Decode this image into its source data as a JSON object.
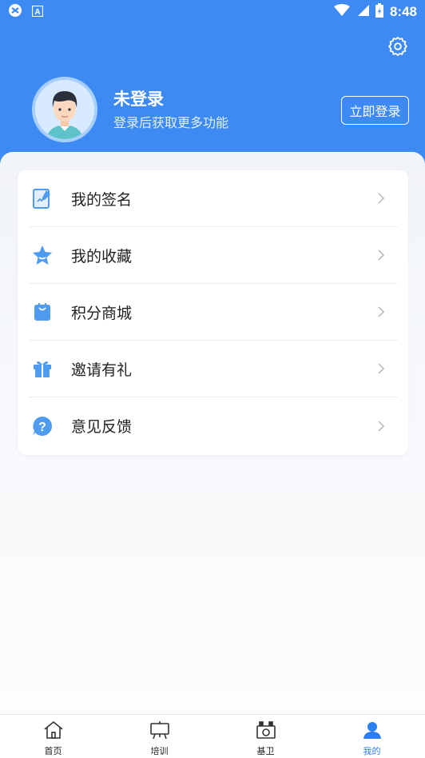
{
  "status_bar": {
    "time": "8:48",
    "left_icons": [
      "app-icon",
      "a-icon"
    ],
    "right_icons": [
      "wifi-icon",
      "signal-icon",
      "battery-icon"
    ]
  },
  "profile": {
    "name": "未登录",
    "subtitle": "登录后获取更多功能",
    "login_button": "立即登录"
  },
  "menu": {
    "items": [
      {
        "label": "我的签名",
        "icon": "signature-icon"
      },
      {
        "label": "我的收藏",
        "icon": "star-icon"
      },
      {
        "label": "积分商城",
        "icon": "shopping-bag-icon"
      },
      {
        "label": "邀请有礼",
        "icon": "gift-icon"
      },
      {
        "label": "意见反馈",
        "icon": "feedback-icon"
      }
    ]
  },
  "tabs": [
    {
      "label": "首页",
      "icon": "home-icon",
      "active": false
    },
    {
      "label": "培训",
      "icon": "training-icon",
      "active": false
    },
    {
      "label": "基卫",
      "icon": "station-icon",
      "active": false
    },
    {
      "label": "我的",
      "icon": "user-icon",
      "active": true
    }
  ],
  "colors": {
    "primary": "#3d8bf2",
    "accent": "#2d7ff0",
    "icon_blue": "#4e9bf0"
  }
}
